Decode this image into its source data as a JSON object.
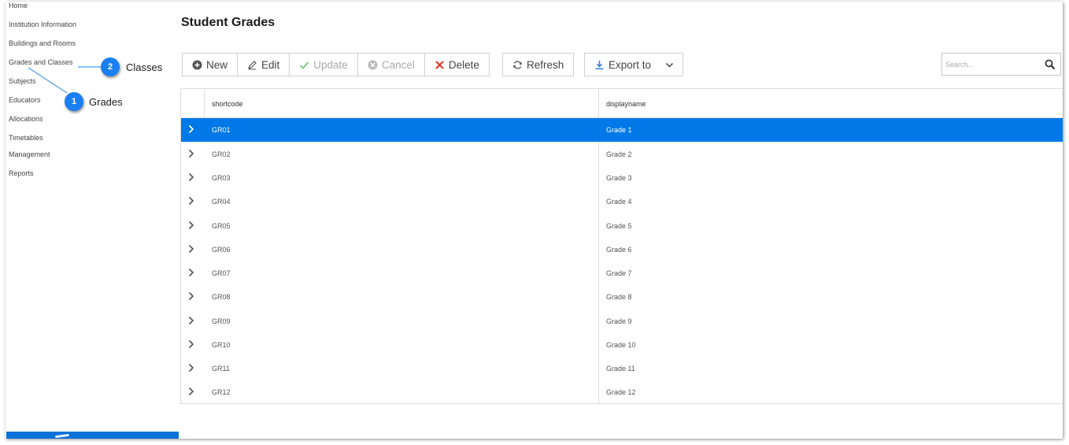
{
  "sidebar": {
    "items": [
      {
        "label": "Home"
      },
      {
        "label": "Institution Information"
      },
      {
        "label": "Buildings and Rooms"
      },
      {
        "label": "Grades and Classes"
      },
      {
        "label": "Subjects"
      },
      {
        "label": "Educators"
      },
      {
        "label": "Allocations"
      },
      {
        "label": "Timetables"
      },
      {
        "label": "Management"
      },
      {
        "label": "Reports"
      }
    ]
  },
  "page": {
    "title": "Student Grades"
  },
  "toolbar": {
    "new": "New",
    "edit": "Edit",
    "update": "Update",
    "cancel": "Cancel",
    "delete": "Delete",
    "refresh": "Refresh",
    "export": "Export to"
  },
  "search": {
    "placeholder": "Search..."
  },
  "grid": {
    "columns": [
      "shortcode",
      "displayname"
    ],
    "rows": [
      {
        "shortcode": "GR01",
        "displayname": "Grade 1"
      },
      {
        "shortcode": "GR02",
        "displayname": "Grade 2"
      },
      {
        "shortcode": "GR03",
        "displayname": "Grade 3"
      },
      {
        "shortcode": "GR04",
        "displayname": "Grade 4"
      },
      {
        "shortcode": "GR05",
        "displayname": "Grade 5"
      },
      {
        "shortcode": "GR06",
        "displayname": "Grade 6"
      },
      {
        "shortcode": "GR07",
        "displayname": "Grade 7"
      },
      {
        "shortcode": "GR08",
        "displayname": "Grade 8"
      },
      {
        "shortcode": "GR09",
        "displayname": "Grade 9"
      },
      {
        "shortcode": "GR10",
        "displayname": "Grade 10"
      },
      {
        "shortcode": "GR11",
        "displayname": "Grade 11"
      },
      {
        "shortcode": "GR12",
        "displayname": "Grade 12"
      }
    ]
  },
  "callouts": [
    {
      "number": "1",
      "label": "Grades"
    },
    {
      "number": "2",
      "label": "Classes"
    }
  ],
  "colors": {
    "selected_row": "#0078e7",
    "callout": "#1a7ff0",
    "delete_icon": "#e0332b",
    "update_icon": "#7bc67b",
    "export_icon": "#3a7fd0"
  }
}
